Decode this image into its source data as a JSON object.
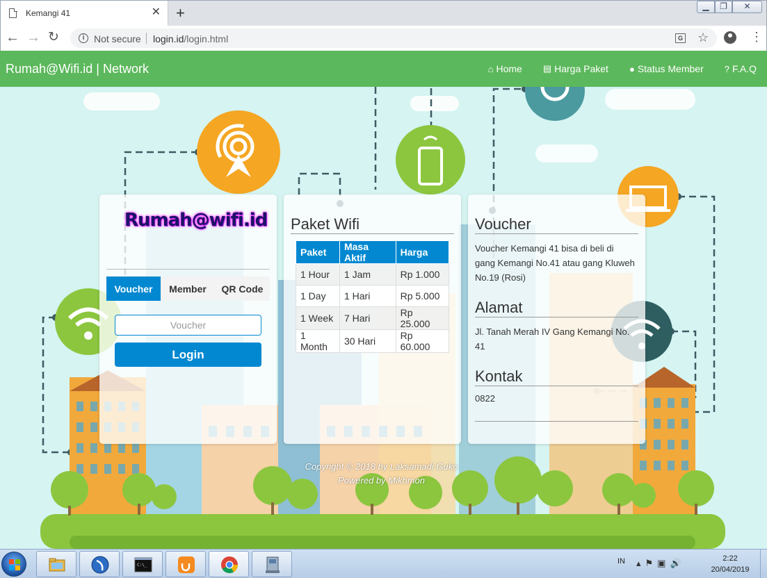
{
  "browser": {
    "tab_title": "Kemangi 41",
    "tab_close": "✕",
    "new_tab": "+",
    "security_label": "Not secure",
    "url_host": "login.id",
    "url_path": "/login.html"
  },
  "navbar": {
    "brand": "Rumah@Wifi.id | Network",
    "links": [
      {
        "icon": "home-icon",
        "label": "Home"
      },
      {
        "icon": "list-icon",
        "label": "Harga Paket"
      },
      {
        "icon": "user-icon",
        "label": "Status Member"
      },
      {
        "icon": "question-icon",
        "label": "F.A.Q"
      }
    ]
  },
  "login": {
    "logo_text": "Rumah@wifi.id",
    "tabs": [
      "Voucher",
      "Member",
      "QR Code"
    ],
    "voucher_placeholder": "Voucher",
    "voucher_value": "",
    "login_button": "Login"
  },
  "paket": {
    "title": "Paket Wifi",
    "headers": [
      "Paket",
      "Masa Aktif",
      "Harga"
    ],
    "rows": [
      [
        "1 Hour",
        "1 Jam",
        "Rp 1.000"
      ],
      [
        "1 Day",
        "1 Hari",
        "Rp 5.000"
      ],
      [
        "1 Week",
        "7 Hari",
        "Rp 25.000"
      ],
      [
        "1 Month",
        "30 Hari",
        "Rp 60.000"
      ]
    ]
  },
  "info": {
    "voucher_title": "Voucher",
    "voucher_text": "Voucher Kemangi 41 bisa di beli di gang Kemangi No.41 atau gang Kluweh No.19 (Rosi)",
    "alamat_title": "Alamat",
    "alamat_text": "Jl. Tanah Merah IV Gang Kemangi No. 41",
    "kontak_title": "Kontak",
    "kontak_text": "0822"
  },
  "footer": {
    "copyright": "Copyright © 2018 by Laksamadi Guko",
    "powered": "Powered by Mikhmon"
  },
  "taskbar": {
    "language": "IN",
    "time": "2:22",
    "date": "20/04/2019"
  },
  "colors": {
    "navbar": "#5cb85c",
    "accent": "#0288d1",
    "page_bg": "#d5f4f2"
  }
}
